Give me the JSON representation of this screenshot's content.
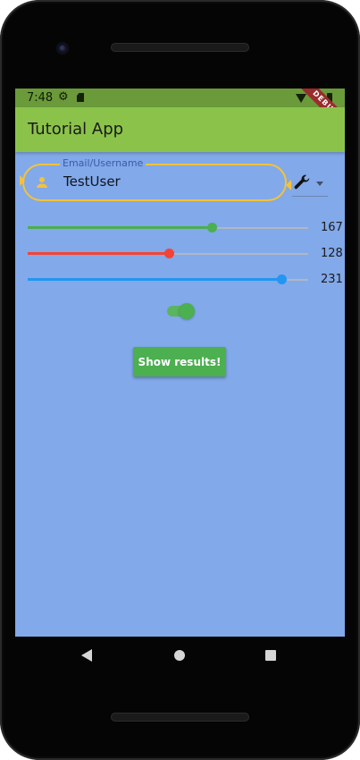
{
  "statusbar": {
    "time": "7:48",
    "icons": [
      "gear-icon",
      "sd-card-icon",
      "wifi-icon",
      "battery-icon"
    ]
  },
  "debug_banner": "DEBUG",
  "appbar": {
    "title": "Tutorial App"
  },
  "email_field": {
    "label": "Email/Username",
    "value": "TestUser",
    "icon": "person-icon"
  },
  "dropdown": {
    "selected_icon": "wrench-icon"
  },
  "sliders": [
    {
      "value": "167",
      "fraction": 0.655,
      "color": "#4caf50"
    },
    {
      "value": "128",
      "fraction": 0.502,
      "color": "#f44336"
    },
    {
      "value": "231",
      "fraction": 0.906,
      "color": "#2196f3"
    }
  ],
  "toggle": {
    "on": true
  },
  "button": {
    "label": "Show results!"
  },
  "colors": {
    "appbar": "#8bc34a",
    "background": "#82a9e9",
    "field_border": "#f4c23a"
  }
}
